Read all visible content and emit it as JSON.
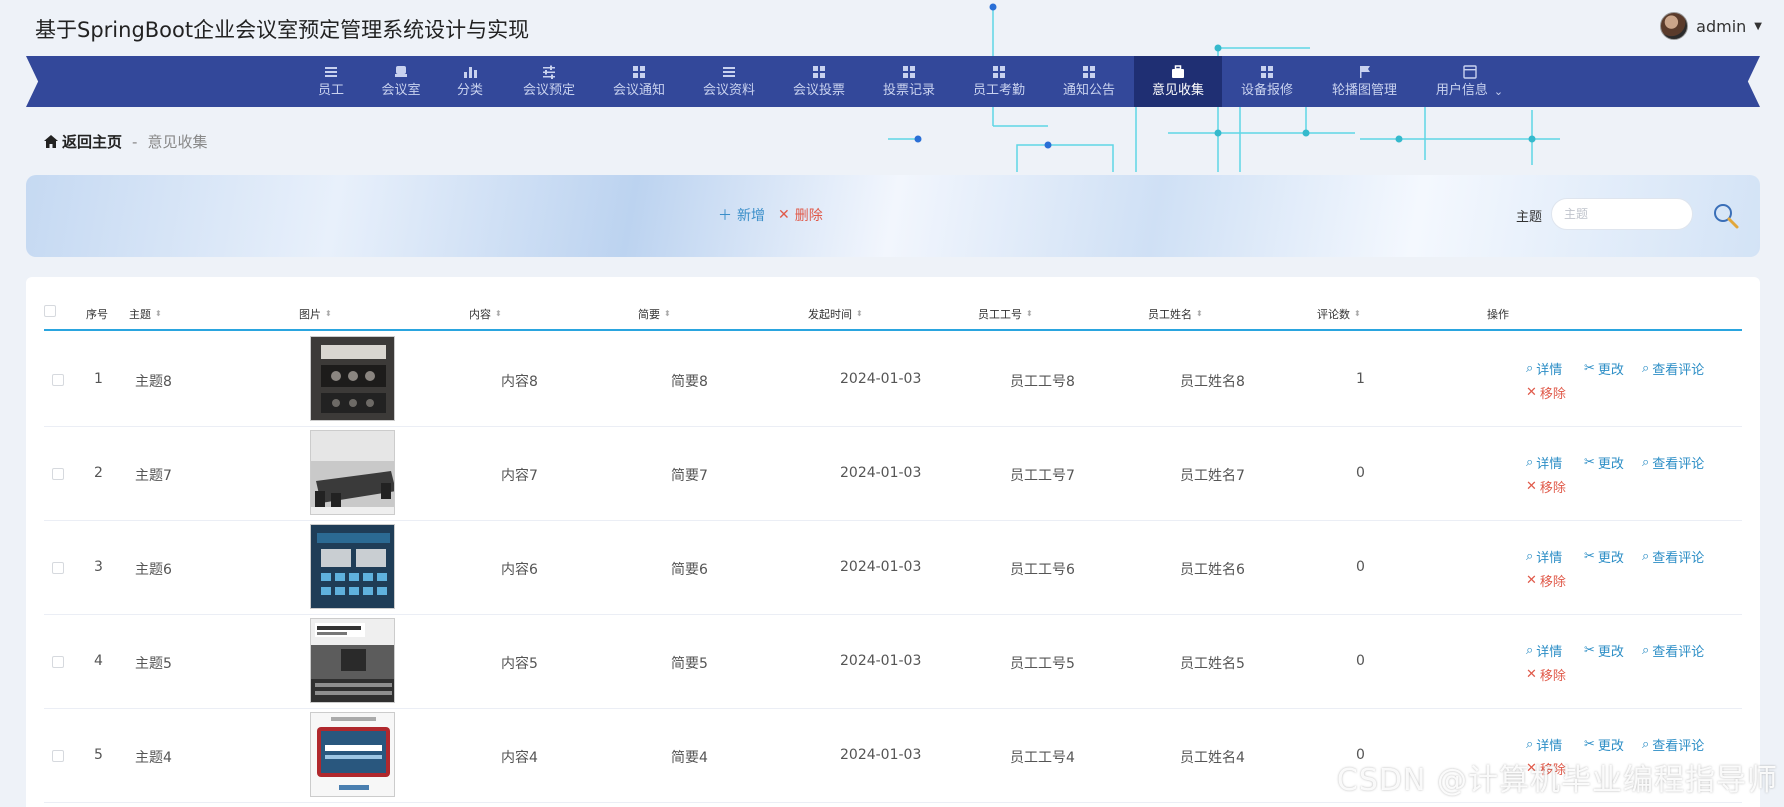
{
  "app_title": "基于SpringBoot企业会议室预定管理系统设计与实现",
  "user": {
    "name": "admin"
  },
  "nav": {
    "items": [
      {
        "label": "员工",
        "icon": "list-icon"
      },
      {
        "label": "会议室",
        "icon": "chair-icon"
      },
      {
        "label": "分类",
        "icon": "bar-chart-icon"
      },
      {
        "label": "会议预定",
        "icon": "sliders-icon"
      },
      {
        "label": "会议通知",
        "icon": "grid-icon"
      },
      {
        "label": "会议资料",
        "icon": "list-icon"
      },
      {
        "label": "会议投票",
        "icon": "grid-icon"
      },
      {
        "label": "投票记录",
        "icon": "grid-icon"
      },
      {
        "label": "员工考勤",
        "icon": "grid-icon"
      },
      {
        "label": "通知公告",
        "icon": "grid-icon"
      },
      {
        "label": "意见收集",
        "icon": "briefcase-icon"
      },
      {
        "label": "设备报修",
        "icon": "grid-icon"
      },
      {
        "label": "轮播图管理",
        "icon": "flag-icon"
      },
      {
        "label": "用户信息",
        "icon": "window-icon"
      }
    ],
    "active": "意见收集"
  },
  "breadcrumb": {
    "home": "返回主页",
    "separator": "-",
    "current": "意见收集"
  },
  "actions": {
    "add_label": "新增",
    "delete_label": "删除"
  },
  "search": {
    "label": "主题",
    "placeholder": "主题",
    "value": ""
  },
  "table": {
    "headers": [
      "序号",
      "主题",
      "图片",
      "内容",
      "简要",
      "发起时间",
      "员工工号",
      "员工姓名",
      "评论数",
      "操作"
    ],
    "rows": [
      {
        "index": "1",
        "topic": "主题8",
        "content": "内容8",
        "summary": "简要8",
        "time": "2024-01-03",
        "emp_no": "员工工号8",
        "emp_name": "员工姓名8",
        "comments": "1"
      },
      {
        "index": "2",
        "topic": "主题7",
        "content": "内容7",
        "summary": "简要7",
        "time": "2024-01-03",
        "emp_no": "员工工号7",
        "emp_name": "员工姓名7",
        "comments": "0"
      },
      {
        "index": "3",
        "topic": "主题6",
        "content": "内容6",
        "summary": "简要6",
        "time": "2024-01-03",
        "emp_no": "员工工号6",
        "emp_name": "员工姓名6",
        "comments": "0"
      },
      {
        "index": "4",
        "topic": "主题5",
        "content": "内容5",
        "summary": "简要5",
        "time": "2024-01-03",
        "emp_no": "员工工号5",
        "emp_name": "员工姓名5",
        "comments": "0"
      },
      {
        "index": "5",
        "topic": "主题4",
        "content": "内容4",
        "summary": "简要4",
        "time": "2024-01-03",
        "emp_no": "员工工号4",
        "emp_name": "员工姓名4",
        "comments": "0"
      }
    ],
    "row_actions": {
      "detail": "详情",
      "edit": "更改",
      "comments": "查看评论",
      "remove": "移除"
    }
  },
  "watermark": "CSDN @计算机毕业编程指导师",
  "colors": {
    "nav_bg": "#33489a",
    "nav_active": "#1f2f73",
    "accent_blue": "#2c8ec6",
    "danger": "#e05a4a",
    "table_rule": "#2aa5df"
  }
}
